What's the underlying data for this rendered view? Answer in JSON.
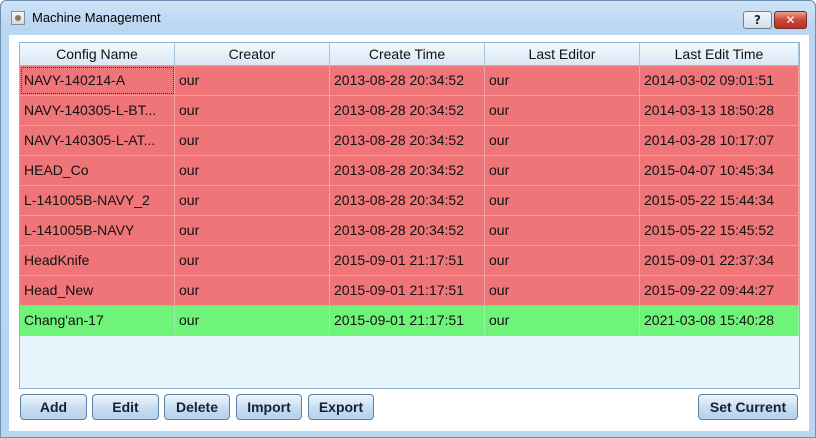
{
  "window": {
    "title": "Machine Management",
    "help_label": "?",
    "close_label": "✕"
  },
  "table": {
    "columns": [
      "Config Name",
      "Creator",
      "Create Time",
      "Last Editor",
      "Last Edit Time"
    ],
    "rows": [
      {
        "status": "red",
        "cells": [
          "NAVY-140214-A",
          "our",
          "2013-08-28 20:34:52",
          "our",
          "2014-03-02 09:01:51"
        ]
      },
      {
        "status": "red",
        "cells": [
          "NAVY-140305-L-BT...",
          "our",
          "2013-08-28 20:34:52",
          "our",
          "2014-03-13 18:50:28"
        ]
      },
      {
        "status": "red",
        "cells": [
          "NAVY-140305-L-AT...",
          "our",
          "2013-08-28 20:34:52",
          "our",
          "2014-03-28 10:17:07"
        ]
      },
      {
        "status": "red",
        "cells": [
          "HEAD_Co",
          "our",
          "2013-08-28 20:34:52",
          "our",
          "2015-04-07 10:45:34"
        ]
      },
      {
        "status": "red",
        "cells": [
          "L-141005B-NAVY_2",
          "our",
          "2013-08-28 20:34:52",
          "our",
          "2015-05-22 15:44:34"
        ]
      },
      {
        "status": "red",
        "cells": [
          "L-141005B-NAVY",
          "our",
          "2013-08-28 20:34:52",
          "our",
          "2015-05-22 15:45:52"
        ]
      },
      {
        "status": "red",
        "cells": [
          "HeadKnife",
          "our",
          "2015-09-01 21:17:51",
          "our",
          "2015-09-01 22:37:34"
        ]
      },
      {
        "status": "red",
        "cells": [
          "Head_New",
          "our",
          "2015-09-01 21:17:51",
          "our",
          "2015-09-22 09:44:27"
        ]
      },
      {
        "status": "green",
        "cells": [
          "Chang'an-17",
          "our",
          "2015-09-01 21:17:51",
          "our",
          "2021-03-08 15:40:28"
        ]
      }
    ]
  },
  "buttons": {
    "add": "Add",
    "edit": "Edit",
    "delete": "Delete",
    "import": "Import",
    "export": "Export",
    "set_current": "Set Current"
  },
  "colors": {
    "row_red": "#ef7579",
    "row_green": "#6ff47a"
  }
}
